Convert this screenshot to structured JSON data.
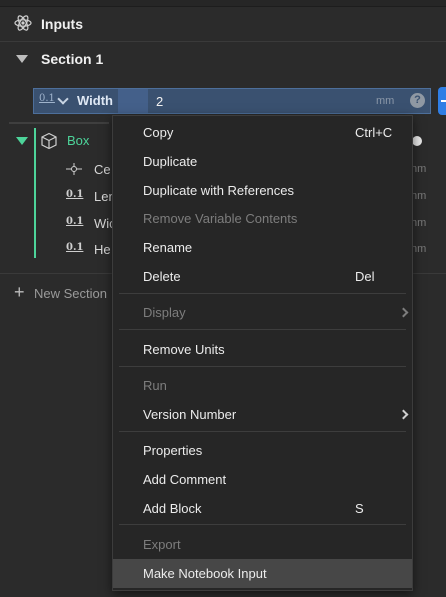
{
  "header": {
    "title": "Inputs",
    "icon": "atom-gear-icon"
  },
  "section": {
    "title": "Section 1"
  },
  "input": {
    "type_badge": "0.1",
    "name": "Width",
    "value": "2",
    "unit": "mm",
    "help": "?"
  },
  "box": {
    "title": "Box",
    "children": [
      {
        "icon": "center-point-icon",
        "label": "Ce",
        "unit": "nm"
      },
      {
        "icon": "0.1",
        "label": "Len",
        "unit": "nm"
      },
      {
        "icon": "0.1",
        "label": "Wic",
        "unit": "nm"
      },
      {
        "icon": "0.1",
        "label": "He",
        "unit": "nm"
      }
    ]
  },
  "new_section": {
    "label": "New Section"
  },
  "context_menu": {
    "items": [
      {
        "label": "Copy",
        "shortcut": "Ctrl+C"
      },
      {
        "label": "Duplicate"
      },
      {
        "label": "Duplicate with References"
      },
      {
        "label": "Remove Variable Contents",
        "disabled": true
      },
      {
        "label": "Rename"
      },
      {
        "label": "Delete",
        "shortcut": "Del"
      },
      {
        "label": "Display",
        "disabled": true,
        "submenu": true
      },
      {
        "label": "Remove Units"
      },
      {
        "label": "Run",
        "disabled": true
      },
      {
        "label": "Version Number",
        "submenu": true
      },
      {
        "label": "Properties"
      },
      {
        "label": "Add Comment"
      },
      {
        "label": "Add Block",
        "shortcut": "S"
      },
      {
        "label": "Export",
        "disabled": true
      },
      {
        "label": "Make Notebook Input",
        "highlighted": true
      }
    ]
  },
  "colors": {
    "accent_blue": "#2f7ee5",
    "selected_row": "#3a5170",
    "block_green": "#4dd49a",
    "menu_bg": "#262626",
    "menu_highlight": "#474747"
  }
}
